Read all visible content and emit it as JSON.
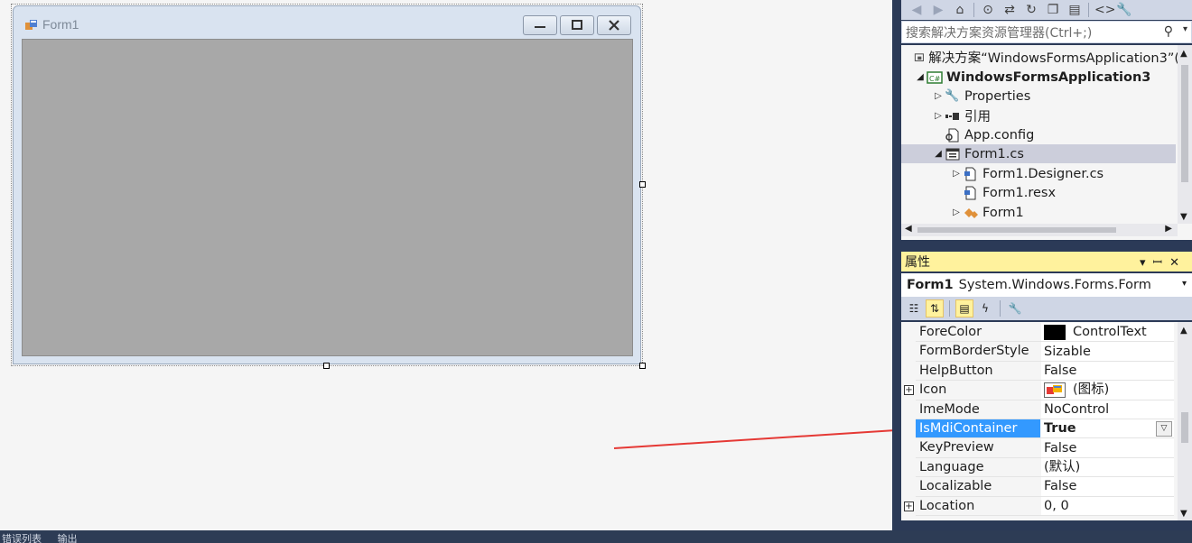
{
  "form": {
    "title": "Form1",
    "caption_buttons": [
      "minimize-icon",
      "maximize-icon",
      "close-icon"
    ]
  },
  "solution_explorer": {
    "toolbar_icons": [
      "back-icon",
      "forward-icon",
      "home-icon",
      "sync-icon",
      "refresh-icon",
      "collapse-icon",
      "copy-icon",
      "code-icon",
      "wrench-icon"
    ],
    "search_placeholder": "搜索解决方案资源管理器(Ctrl+;)",
    "tree": [
      {
        "label": "解决方案“WindowsFormsApplication3”(",
        "icon": "solution-icon",
        "twisty": "",
        "level": 0,
        "bold": false
      },
      {
        "label": "WindowsFormsApplication3",
        "icon": "csharp-project-icon",
        "twisty": "◢",
        "level": 0,
        "bold": true
      },
      {
        "label": "Properties",
        "icon": "wrench-icon",
        "twisty": "▷",
        "level": 1,
        "bold": false
      },
      {
        "label": "引用",
        "icon": "references-icon",
        "twisty": "▷",
        "level": 1,
        "bold": false
      },
      {
        "label": "App.config",
        "icon": "config-file-icon",
        "twisty": "",
        "level": 1,
        "bold": false
      },
      {
        "label": "Form1.cs",
        "icon": "form-file-icon",
        "twisty": "◢",
        "level": 1,
        "bold": false,
        "selected": true
      },
      {
        "label": "Form1.Designer.cs",
        "icon": "cs-file-icon",
        "twisty": "▷",
        "level": 2,
        "bold": false
      },
      {
        "label": "Form1.resx",
        "icon": "resx-file-icon",
        "twisty": "",
        "level": 2,
        "bold": false
      },
      {
        "label": "Form1",
        "icon": "class-icon",
        "twisty": "▷",
        "level": 2,
        "bold": false
      }
    ]
  },
  "properties": {
    "title": "属性",
    "object_name": "Form1",
    "object_type": "System.Windows.Forms.Form",
    "rows": [
      {
        "name": "ForeColor",
        "value": "ControlText",
        "expandable": false,
        "swatch": "#000000"
      },
      {
        "name": "FormBorderStyle",
        "value": "Sizable",
        "expandable": false
      },
      {
        "name": "HelpButton",
        "value": "False",
        "expandable": false
      },
      {
        "name": "Icon",
        "value": "(图标)",
        "expandable": true,
        "icon": "form-icon"
      },
      {
        "name": "ImeMode",
        "value": "NoControl",
        "expandable": false
      },
      {
        "name": "IsMdiContainer",
        "value": "True",
        "expandable": false,
        "selected": true
      },
      {
        "name": "KeyPreview",
        "value": "False",
        "expandable": false
      },
      {
        "name": "Language",
        "value": "(默认)",
        "expandable": false
      },
      {
        "name": "Localizable",
        "value": "False",
        "expandable": false
      },
      {
        "name": "Location",
        "value": "0, 0",
        "expandable": true
      }
    ]
  },
  "annotation": {
    "color": "#e53935"
  },
  "statusbar": {
    "items": [
      "错误列表",
      "输出"
    ]
  }
}
